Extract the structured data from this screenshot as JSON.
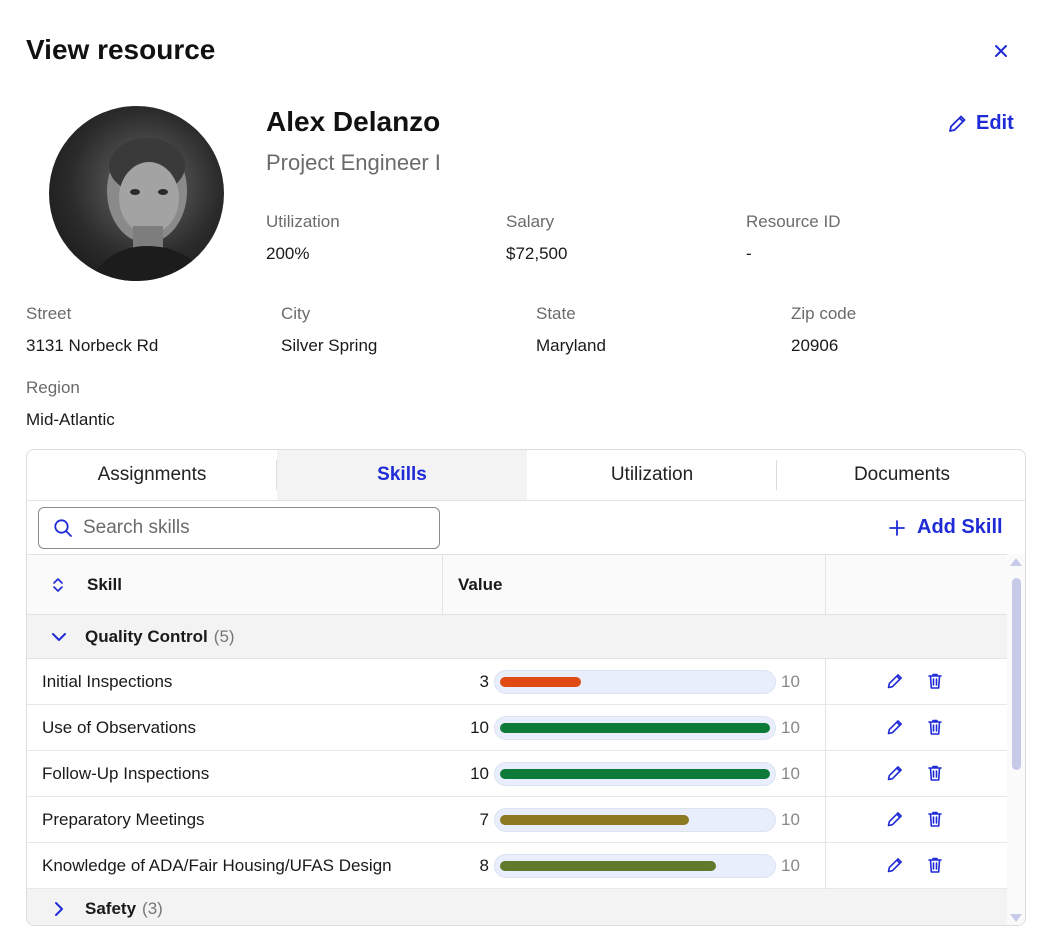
{
  "header": {
    "title": "View resource"
  },
  "profile": {
    "name": "Alex Delanzo",
    "role": "Project Engineer I",
    "edit_label": "Edit"
  },
  "fields": {
    "utilization": {
      "label": "Utilization",
      "value": "200%"
    },
    "salary": {
      "label": "Salary",
      "value": "$72,500"
    },
    "resource_id": {
      "label": "Resource ID",
      "value": "-"
    },
    "street": {
      "label": "Street",
      "value": "3131 Norbeck Rd"
    },
    "city": {
      "label": "City",
      "value": "Silver Spring"
    },
    "state": {
      "label": "State",
      "value": "Maryland"
    },
    "zip": {
      "label": "Zip code",
      "value": "20906"
    },
    "region": {
      "label": "Region",
      "value": "Mid-Atlantic"
    }
  },
  "tabs": [
    {
      "label": "Assignments",
      "active": false
    },
    {
      "label": "Skills",
      "active": true
    },
    {
      "label": "Utilization",
      "active": false
    },
    {
      "label": "Documents",
      "active": false
    }
  ],
  "skills_panel": {
    "search_placeholder": "Search skills",
    "search_value": "",
    "add_label": "Add Skill",
    "columns": {
      "skill": "Skill",
      "value": "Value"
    },
    "groups": [
      {
        "name": "Quality Control",
        "count": "(5)",
        "expanded": true,
        "rows": [
          {
            "name": "Initial Inspections",
            "value": "3",
            "max": "10",
            "color": "#e04a14"
          },
          {
            "name": "Use of Observations",
            "value": "10",
            "max": "10",
            "color": "#0e7a3a"
          },
          {
            "name": "Follow-Up Inspections",
            "value": "10",
            "max": "10",
            "color": "#0e7a3a"
          },
          {
            "name": "Preparatory Meetings",
            "value": "7",
            "max": "10",
            "color": "#8c7a22"
          },
          {
            "name": "Knowledge of ADA/Fair Housing/UFAS Design",
            "value": "8",
            "max": "10",
            "color": "#5f7a2a"
          }
        ]
      },
      {
        "name": "Safety",
        "count": "(3)",
        "expanded": false,
        "rows": []
      }
    ]
  },
  "colors": {
    "accent": "#1f2bd6"
  }
}
